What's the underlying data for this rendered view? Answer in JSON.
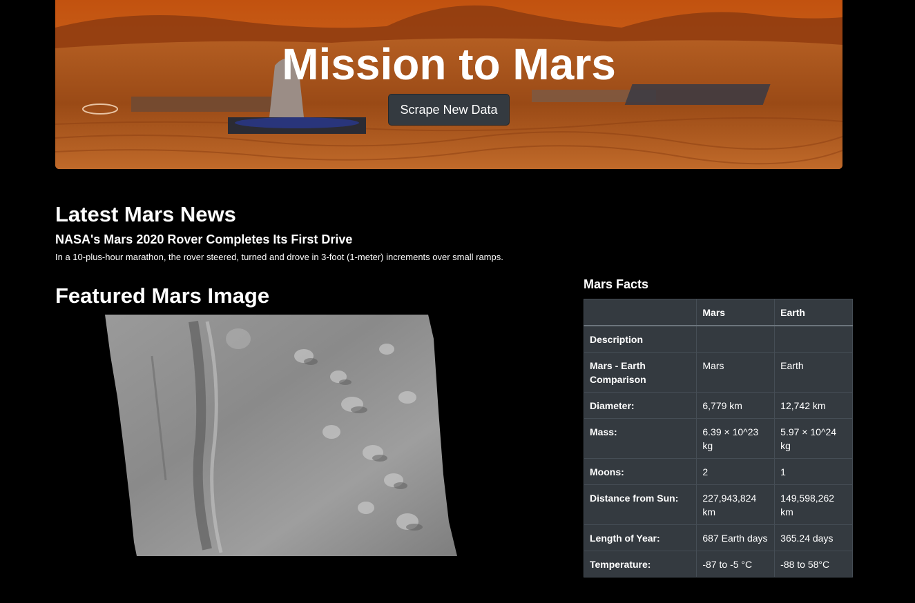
{
  "hero": {
    "title": "Mission to Mars",
    "button_label": "Scrape New Data"
  },
  "news": {
    "heading": "Latest Mars News",
    "title": "NASA's Mars 2020 Rover Completes Its First Drive",
    "teaser": "In a 10-plus-hour marathon, the rover steered, turned and drove in 3-foot (1-meter) increments over small ramps."
  },
  "featured": {
    "heading": "Featured Mars Image"
  },
  "facts": {
    "heading": "Mars Facts",
    "columns": [
      "",
      "Mars",
      "Earth"
    ],
    "rows": [
      {
        "label": "Description",
        "mars": "",
        "earth": ""
      },
      {
        "label": "Mars - Earth Comparison",
        "mars": "Mars",
        "earth": "Earth"
      },
      {
        "label": "Diameter:",
        "mars": "6,779 km",
        "earth": "12,742 km"
      },
      {
        "label": "Mass:",
        "mars": "6.39 × 10^23 kg",
        "earth": "5.97 × 10^24 kg"
      },
      {
        "label": "Moons:",
        "mars": "2",
        "earth": "1"
      },
      {
        "label": "Distance from Sun:",
        "mars": "227,943,824 km",
        "earth": "149,598,262 km"
      },
      {
        "label": "Length of Year:",
        "mars": "687 Earth days",
        "earth": "365.24 days"
      },
      {
        "label": "Temperature:",
        "mars": "-87 to -5 °C",
        "earth": "-88 to 58°C"
      }
    ]
  },
  "colors": {
    "background": "#000000",
    "button_bg": "#343a40",
    "table_bg": "#343a40"
  }
}
